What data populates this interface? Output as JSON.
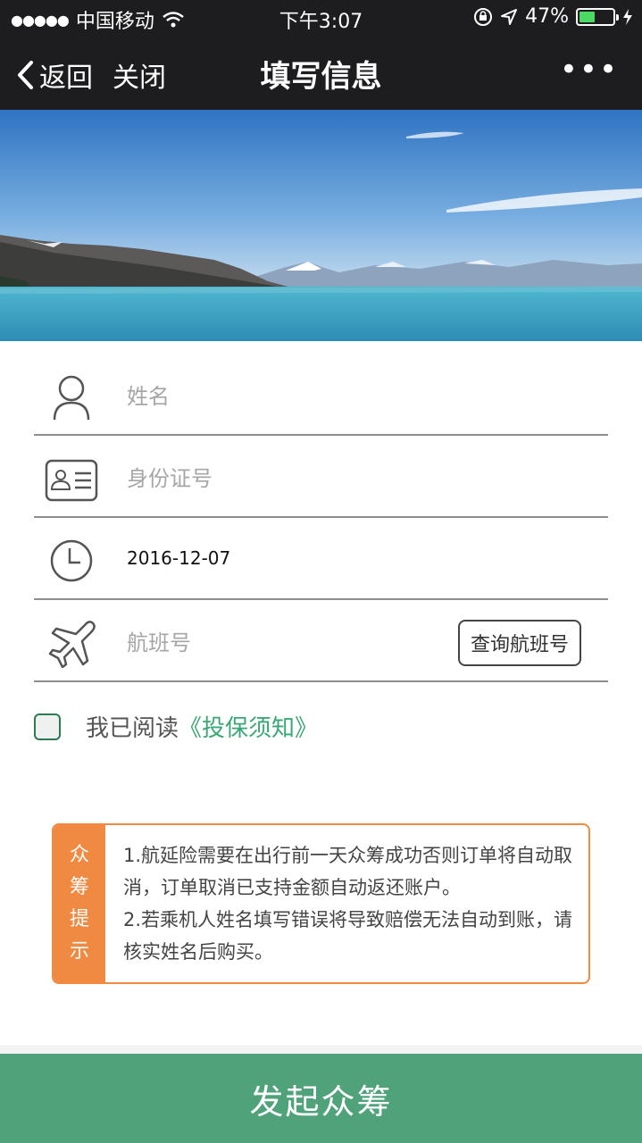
{
  "status_bar": {
    "carrier": "中国移动",
    "time": "下午3:07",
    "battery": "47%",
    "battery_level": 0.47
  },
  "nav": {
    "back_label": "返回",
    "close_label": "关闭",
    "title": "填写信息",
    "more_label": "•••"
  },
  "form": {
    "name": {
      "placeholder": "姓名",
      "icon": "user-icon"
    },
    "id_number": {
      "placeholder": "身份证号",
      "icon": "id-card-icon"
    },
    "date": {
      "value": "2016-12-07",
      "icon": "clock-icon"
    },
    "flight": {
      "placeholder": "航班号",
      "icon": "airplane-icon",
      "query_button": "查询航班号"
    }
  },
  "agreement": {
    "prefix": "我已阅读",
    "link": "《投保须知》"
  },
  "notice": {
    "tag": [
      "众",
      "筹",
      "提",
      "示"
    ],
    "lines": [
      "1.航延险需要在出行前一天众筹成功否则订单将自动取消，订单取消已支持金额自动返还账户。",
      "2.若乘机人姓名填写错误将导致赔偿无法自动到账，请核实姓名后购买。"
    ]
  },
  "submit_label": "发起众筹",
  "colors": {
    "nav_bg": "#1d1d1f",
    "accent_green": "#4fa27a",
    "notice_orange": "#f08a42"
  }
}
